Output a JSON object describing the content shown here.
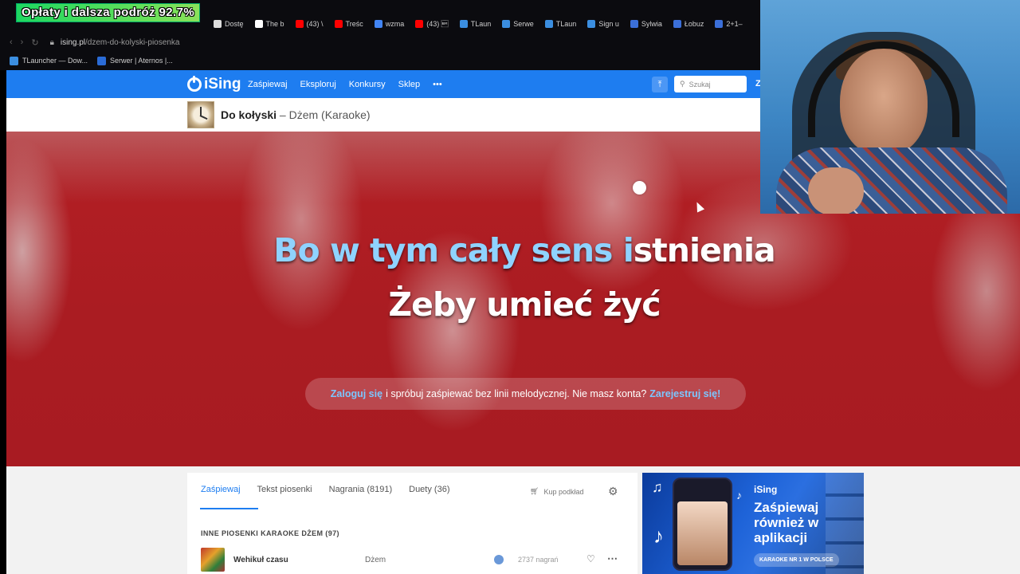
{
  "overlay": {
    "badge_text": "Opłaty i dalsza podróż 92.7%"
  },
  "browser": {
    "tabs": [
      {
        "label": "Dostę",
        "color": "#dddddd"
      },
      {
        "label": "The b",
        "color": "#ffffff"
      },
      {
        "label": "(43) \\",
        "color": "#ff0000"
      },
      {
        "label": "Treśc",
        "color": "#ff0000"
      },
      {
        "label": "wzma",
        "color": "#4285f4"
      },
      {
        "label": "(43) \u0019",
        "color": "#ff0000"
      },
      {
        "label": "TLaun",
        "color": "#3b8ee0"
      },
      {
        "label": "Serwe",
        "color": "#3b8ee0"
      },
      {
        "label": "TLaun",
        "color": "#3b8ee0"
      },
      {
        "label": "Sign u",
        "color": "#3b8ee0"
      },
      {
        "label": "Sylwia",
        "color": "#3b6fd8"
      },
      {
        "label": "Łobuz",
        "color": "#3b6fd8"
      },
      {
        "label": "2+1–",
        "color": "#3b6fd8"
      }
    ],
    "url_domain": "ising.pl",
    "url_path": "/dzem-do-kolyski-piosenka",
    "bookmarks": [
      {
        "label": "TLauncher — Dow...",
        "color": "#3b8ee0"
      },
      {
        "label": "Serwer | Aternos |...",
        "color": "#2a6bd6"
      }
    ]
  },
  "header": {
    "logo": "iSing",
    "nav": [
      "Zaśpiewaj",
      "Eksploruj",
      "Konkursy",
      "Sklep",
      "•••"
    ],
    "search_placeholder": "Szukaj",
    "trailing": "Z"
  },
  "song": {
    "title": "Do kołyski",
    "separator": " – ",
    "artist": "Dżem (Karaoke)"
  },
  "karaoke": {
    "line1_sung": "Bo w tym cały sens i",
    "line1_unsung": "stnienia",
    "line2": "Żeby umieć żyć",
    "notice_login": "Zaloguj się",
    "notice_text": "i spróbuj zaśpiewać bez linii melodycznej. Nie masz konta?",
    "notice_register": "Zarejestruj się!"
  },
  "panel": {
    "tabs": [
      "Zaśpiewaj",
      "Tekst piosenki",
      "Nagrania (8191)",
      "Duety (36)"
    ],
    "buy_label": "Kup podkład",
    "section_title": "INNE PIOSENKI KARAOKE DŻEM (97)",
    "rows": [
      {
        "name": "Wehikuł czasu",
        "artist": "Dżem",
        "count": "2737 nagrań"
      }
    ]
  },
  "ad": {
    "brand": "iSing",
    "headline": "Zaśpiewaj również w aplikacji",
    "pill": "KARAOKE NR 1 W POLSCE"
  },
  "colors": {
    "brand_blue": "#1e7df0",
    "stage_red": "#b41f24",
    "lyric_sung": "#8fd3ff"
  }
}
